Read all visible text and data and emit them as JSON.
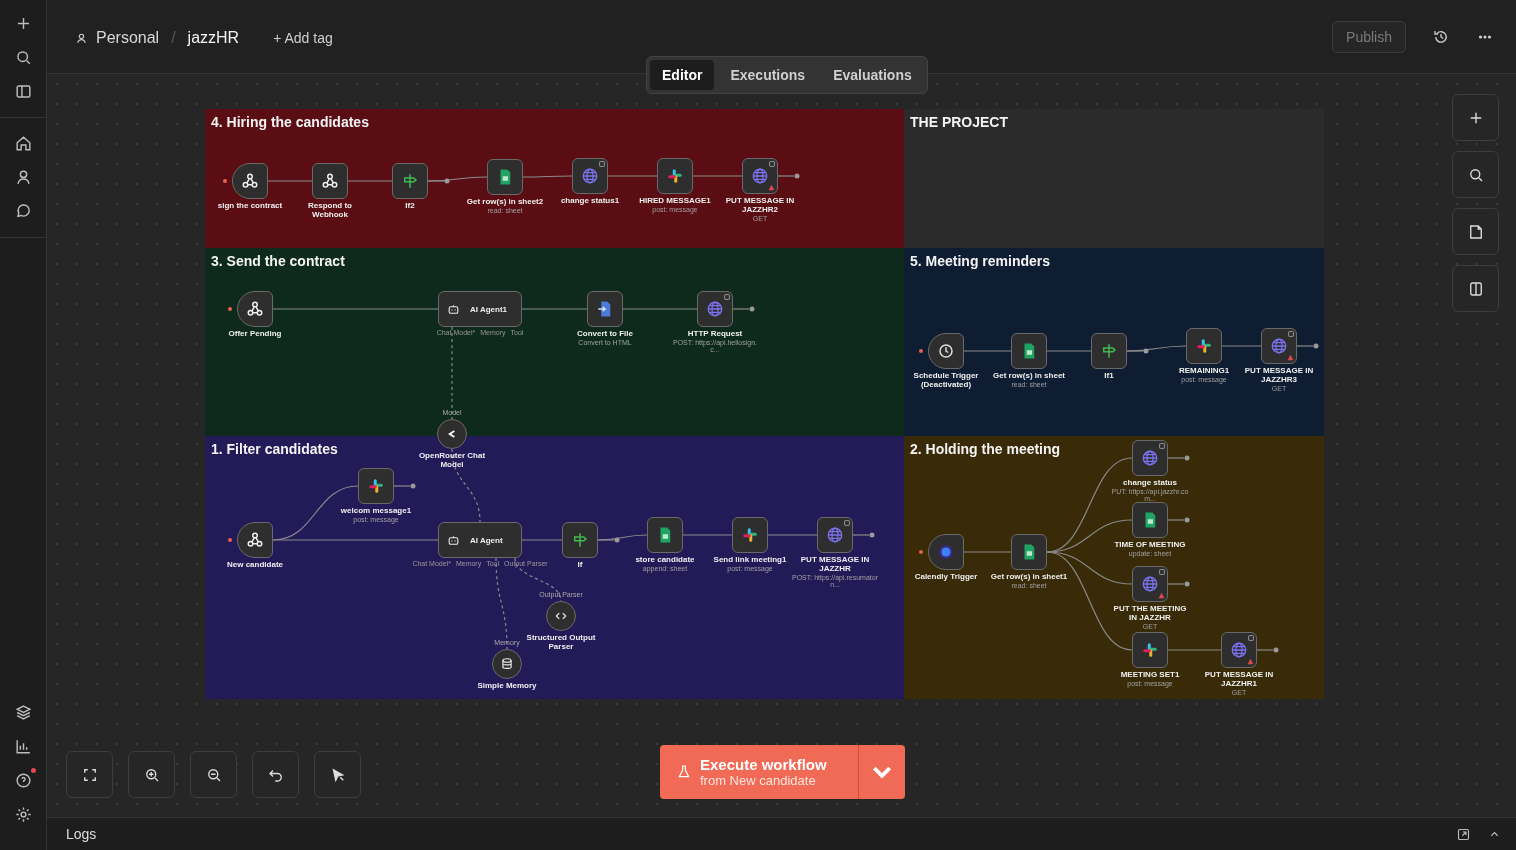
{
  "sidebar": {
    "help_notification": true
  },
  "header": {
    "owner": "Personal",
    "separator": "/",
    "workflow": "jazzHR",
    "add_tag": "+ Add tag",
    "publish": {
      "label": "Publish",
      "disabled": true
    }
  },
  "tabs": [
    {
      "label": "Editor",
      "selected": true
    },
    {
      "label": "Executions",
      "selected": false
    },
    {
      "label": "Evaluations",
      "selected": false
    }
  ],
  "sections": [
    {
      "title": "4. Hiring the candidates",
      "color": "#5a0e14",
      "nodes": [
        {
          "kind": "webhook",
          "label": "sign the contract",
          "trigger": true,
          "warning": false
        },
        {
          "kind": "webhook",
          "label": "Respond to Webhook",
          "trigger": false,
          "warning": false
        },
        {
          "kind": "if",
          "label": "If2",
          "trigger": false,
          "warning": false
        },
        {
          "kind": "sheets",
          "label": "Get row(s) in sheet2",
          "subtitle": "read: sheet",
          "trigger": false,
          "warning": false
        },
        {
          "kind": "http",
          "label": "change status1",
          "trigger": false,
          "warning": false
        },
        {
          "kind": "slack",
          "label": "HIRED MESSAGE1",
          "subtitle": "post: message",
          "trigger": false,
          "warning": false
        },
        {
          "kind": "http",
          "label": "PUT MESSAGE IN JAZZHR2",
          "subtitle": "GET",
          "trigger": false,
          "warning": true
        }
      ]
    },
    {
      "title": "THE PROJECT",
      "color": "#2b2b2b"
    },
    {
      "title": "3. Send the contract",
      "color": "#0d2a1c",
      "nodes": [
        {
          "kind": "webhook",
          "label": "Offer Pending",
          "trigger": true,
          "warning": false
        },
        {
          "kind": "agent",
          "label": "AI Agent1",
          "ports": [
            "Chat Model*",
            "Memory",
            "Tool"
          ],
          "trigger": false,
          "warning": false
        },
        {
          "kind": "convert",
          "label": "Convert to File",
          "subtitle": "Convert to HTML",
          "trigger": false,
          "warning": false
        },
        {
          "kind": "http",
          "label": "HTTP Request",
          "subtitle": "POST: https://api.hellosign.c...",
          "trigger": false,
          "warning": false
        }
      ]
    },
    {
      "title": "5. Meeting reminders",
      "color": "#0e1d32",
      "nodes": [
        {
          "kind": "schedule",
          "label": "Schedule Trigger (Deactivated)",
          "trigger": true,
          "warning": false
        },
        {
          "kind": "sheets",
          "label": "Get row(s) in sheet",
          "subtitle": "read: sheet",
          "trigger": false,
          "warning": false
        },
        {
          "kind": "if",
          "label": "If1",
          "trigger": false,
          "warning": false
        },
        {
          "kind": "slack",
          "label": "REMAINING1",
          "subtitle": "post: message",
          "trigger": false,
          "warning": false
        },
        {
          "kind": "http",
          "label": "PUT MESSAGE IN JAZZHR3",
          "subtitle": "GET",
          "trigger": false,
          "warning": true
        }
      ]
    },
    {
      "title": "1. Filter candidates",
      "color": "#231a58",
      "nodes": [
        {
          "kind": "webhook",
          "label": "New candidate",
          "trigger": true,
          "warning": false
        },
        {
          "kind": "slack",
          "label": "welcom message1",
          "subtitle": "post: message",
          "trigger": false,
          "warning": false
        },
        {
          "kind": "model",
          "label": "OpenRouter Chat Model",
          "top_label": "Model",
          "trigger": false,
          "warning": false
        },
        {
          "kind": "agent",
          "label": "AI Agent",
          "ports": [
            "Chat Model*",
            "Memory",
            "Tool",
            "Output Parser"
          ],
          "trigger": false,
          "warning": false
        },
        {
          "kind": "if",
          "label": "If",
          "trigger": false,
          "warning": false
        },
        {
          "kind": "sheets",
          "label": "store candidate",
          "subtitle": "append: sheet",
          "trigger": false,
          "warning": false
        },
        {
          "kind": "slack",
          "label": "Send link meeting1",
          "subtitle": "post: message",
          "trigger": false,
          "warning": false
        },
        {
          "kind": "http",
          "label": "PUT MESSAGE IN JAZZHR",
          "subtitle": "POST: https://api.resumatorn...",
          "trigger": false,
          "warning": false
        },
        {
          "kind": "parser",
          "label": "Structured Output Parser",
          "top_label": "Output Parser",
          "trigger": false,
          "warning": false
        },
        {
          "kind": "memory",
          "label": "Simple Memory",
          "top_label": "Memory",
          "trigger": false,
          "warning": false
        }
      ]
    },
    {
      "title": "2. Holding the meeting",
      "color": "#392b08",
      "nodes": [
        {
          "kind": "calendly",
          "label": "Calendly Trigger",
          "trigger": true,
          "warning": false
        },
        {
          "kind": "sheets",
          "label": "Get row(s) in sheet1",
          "subtitle": "read: sheet",
          "trigger": false,
          "warning": false
        },
        {
          "kind": "http",
          "label": "change status",
          "subtitle": "PUT: https://api.jazzhr.com...",
          "trigger": false,
          "warning": false
        },
        {
          "kind": "sheets",
          "label": "TIME OF MEETING",
          "subtitle": "update: sheet",
          "trigger": false,
          "warning": false
        },
        {
          "kind": "http",
          "label": "PUT THE MEETING IN JAZZHR",
          "subtitle": "GET",
          "trigger": false,
          "warning": true
        },
        {
          "kind": "slack",
          "label": "MEETING SET1",
          "subtitle": "post: message",
          "trigger": false,
          "warning": false
        },
        {
          "kind": "http",
          "label": "PUT MESSAGE IN JAZZHR1",
          "subtitle": "GET",
          "trigger": false,
          "warning": true
        }
      ]
    }
  ],
  "execute": {
    "label": "Execute workflow",
    "sublabel": "from New candidate"
  },
  "logs": {
    "label": "Logs"
  }
}
